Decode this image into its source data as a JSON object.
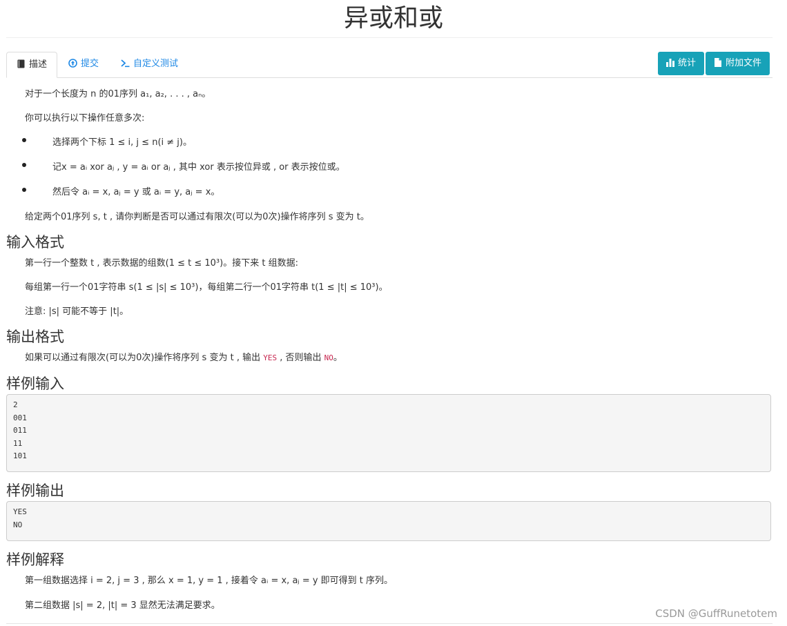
{
  "title": "异或和或",
  "tabs": [
    {
      "label": "描述",
      "icon": "book-icon",
      "active": true
    },
    {
      "label": "提交",
      "icon": "upload-circle-icon",
      "active": false
    },
    {
      "label": "自定义测试",
      "icon": "terminal-icon",
      "active": false
    }
  ],
  "buttons": {
    "stats_label": "统计",
    "stats_icon": "bar-chart-icon",
    "attachment_label": "附加文件",
    "attachment_icon": "file-icon"
  },
  "description": {
    "p1": "对于一个长度为 n 的01序列 a₁, a₂, . . . , aₙ。",
    "p2": "你可以执行以下操作任意多次:",
    "items": [
      "选择两个下标 1 ≤ i, j ≤ n(i ≠ j)。",
      "记x = aᵢ xor aⱼ , y = aᵢ or aⱼ , 其中 xor 表示按位异或 , or 表示按位或。",
      "然后令 aᵢ = x, aⱼ = y 或 aᵢ = y, aⱼ = x。"
    ],
    "p3": "给定两个01序列 s, t , 请你判断是否可以通过有限次(可以为0次)操作将序列 s 变为 t。"
  },
  "input_format": {
    "heading": "输入格式",
    "p1": "第一行一个整数 t , 表示数据的组数(1 ≤ t ≤ 10³)。接下来 t 组数据:",
    "p2": "每组第一行一个01字符串 s(1 ≤ |s| ≤ 10³)，每组第二行一个01字符串 t(1 ≤ |t| ≤ 10³)。",
    "p3": "注意: |s| 可能不等于 |t|。"
  },
  "output_format": {
    "heading": "输出格式",
    "text_a": "如果可以通过有限次(可以为0次)操作将序列 s 变为 t , 输出 ",
    "yes": "YES",
    "text_b": " , 否则输出 ",
    "no": "NO",
    "text_c": "。"
  },
  "sample_input": {
    "heading": "样例输入",
    "content": "2\n001\n011\n11\n101"
  },
  "sample_output": {
    "heading": "样例输出",
    "content": "YES\nNO"
  },
  "explanation": {
    "heading": "样例解释",
    "p1": "第一组数据选择 i = 2, j = 3 , 那么 x = 1, y = 1 , 接着令 aᵢ = x, aⱼ = y 即可得到 t 序列。",
    "p2": "第二组数据 |s| = 2, |t| = 3 显然无法满足要求。"
  },
  "watermark": "CSDN @GuffRunetotem",
  "colors": {
    "link": "#1e88e5",
    "button": "#17a2b8",
    "code": "#c7254e"
  }
}
